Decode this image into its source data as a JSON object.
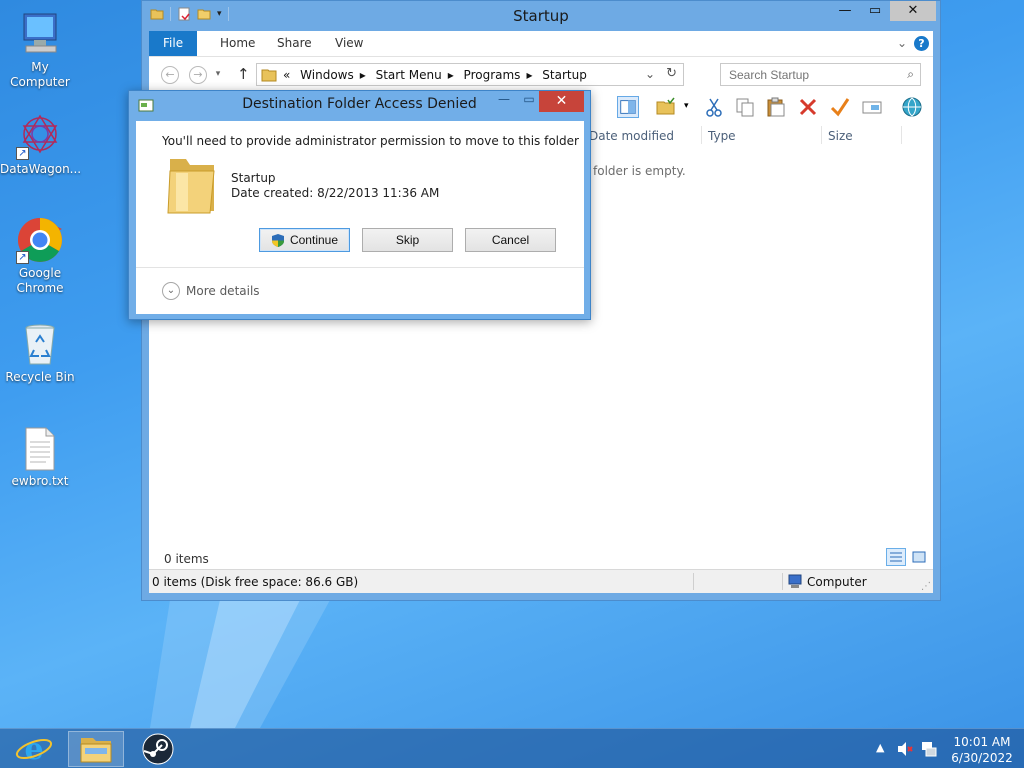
{
  "desktop": {
    "icons": [
      {
        "label": "My Computer"
      },
      {
        "label": "DataWagon..."
      },
      {
        "label": "Google Chrome"
      },
      {
        "label": "Recycle Bin"
      },
      {
        "label": "ewbro.txt"
      }
    ]
  },
  "explorer": {
    "title": "Startup",
    "ribbon_tabs": [
      "File",
      "Home",
      "Share",
      "View"
    ],
    "breadcrumb": [
      "Windows",
      "Start Menu",
      "Programs",
      "Startup"
    ],
    "breadcrumb_prefix": "«",
    "search_placeholder": "Search Startup",
    "columns": [
      "Date modified",
      "Type",
      "Size"
    ],
    "empty_message": "folder is empty.",
    "items_count": "0 items",
    "status_left": "0 items (Disk free space: 86.6 GB)",
    "status_right": "Computer"
  },
  "dialog": {
    "title": "Destination Folder Access Denied",
    "message": "You'll need to provide administrator permission to move to this folder",
    "folder_name": "Startup",
    "date_created": "Date created: 8/22/2013 11:36 AM",
    "buttons": {
      "continue": "Continue",
      "skip": "Skip",
      "cancel": "Cancel"
    },
    "more_details": "More details",
    "close_glyph": "✕"
  },
  "taskbar": {
    "time": "10:01 AM",
    "date": "6/30/2022",
    "apps": [
      "internet-explorer",
      "file-explorer",
      "steam"
    ]
  },
  "colors": {
    "accent": "#1979ca",
    "dialog_frame": "#71aee8",
    "close_red": "#c7443a"
  }
}
